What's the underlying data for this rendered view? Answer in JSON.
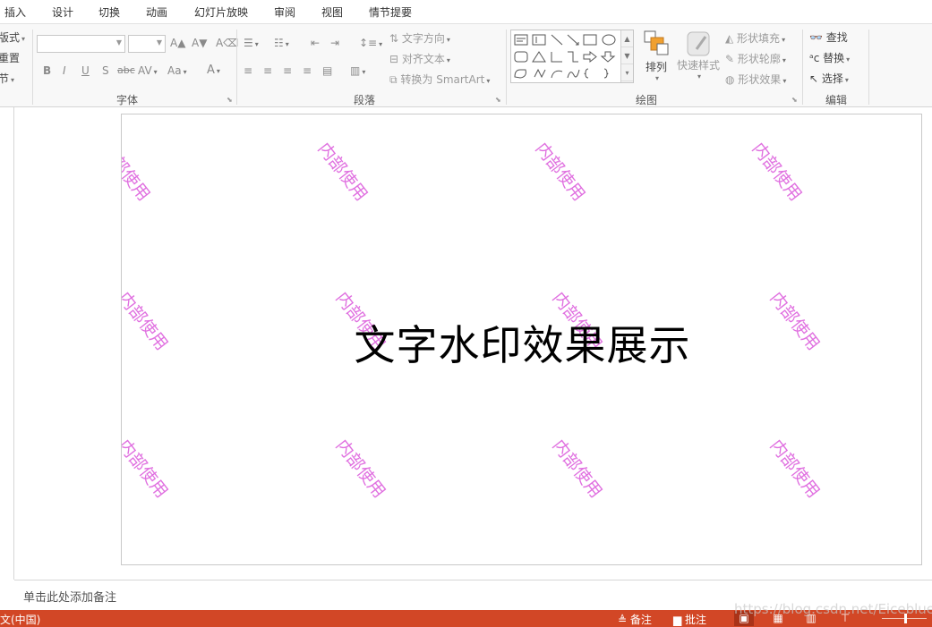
{
  "menu": {
    "tabs": [
      "插入",
      "设计",
      "切换",
      "动画",
      "幻灯片放映",
      "审阅",
      "视图",
      "情节提要"
    ]
  },
  "ribbon": {
    "slides_group": {
      "items": [
        "版式",
        "重置",
        "节"
      ]
    },
    "font_group": {
      "label": "字体",
      "font_name_value": "",
      "font_size_value": "",
      "grow_icon": "A▲",
      "shrink_icon": "A▼",
      "clear_icon": "A⌫",
      "bold": "B",
      "italic": "I",
      "underline": "U",
      "shadow": "S",
      "strike": "abc",
      "spacing": "AV",
      "case": "Aa",
      "color": "A"
    },
    "paragraph_group": {
      "label": "段落",
      "text_direction": "文字方向",
      "align_text": "对齐文本",
      "convert_smartart": "转换为 SmartArt"
    },
    "drawing_group": {
      "label": "绘图",
      "arrange": "排列",
      "quick_styles": "快速样式",
      "shape_fill": "形状填充",
      "shape_outline": "形状轮廓",
      "shape_effects": "形状效果"
    },
    "editing_group": {
      "label": "编辑",
      "find": "查找",
      "replace": "替换",
      "select": "选择"
    }
  },
  "slide": {
    "title": "文字水印效果展示",
    "watermark_text": "内部使用"
  },
  "notes": {
    "placeholder": "单击此处添加备注"
  },
  "statusbar": {
    "language": "文(中国)",
    "notes_label": "备注",
    "comments_label": "批注"
  },
  "overlay": {
    "url": "https://blog.csdn.net/Eiceblue"
  },
  "colors": {
    "statusbar": "#d24726",
    "watermark": "#e070e0",
    "ribbon_bg": "#f8f8f8"
  }
}
